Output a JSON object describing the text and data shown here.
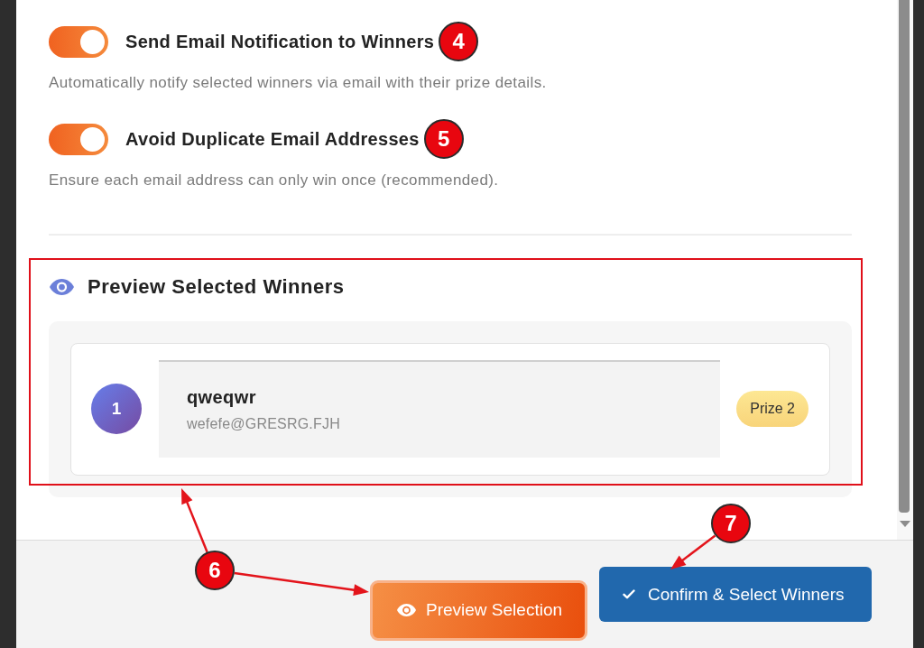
{
  "settings": [
    {
      "label": "Send Email Notification to Winners",
      "on": true,
      "callout": "4",
      "description": "Automatically notify selected winners via email with their prize details."
    },
    {
      "label": "Avoid Duplicate Email Addresses",
      "on": true,
      "callout": "5",
      "description": "Ensure each email address can only win once (recommended)."
    }
  ],
  "preview": {
    "title": "Preview Selected Winners",
    "highlighted": true,
    "winners": [
      {
        "rank": "1",
        "name": "qweqwr",
        "email": "wefefe@GRESRG.FJH",
        "prize": "Prize 2"
      }
    ]
  },
  "footer": {
    "buttons": [
      {
        "kind": "preview",
        "label": "Preview Selection",
        "callout": "6"
      },
      {
        "kind": "confirm",
        "label": "Confirm & Select Winners",
        "callout": "7"
      }
    ]
  }
}
